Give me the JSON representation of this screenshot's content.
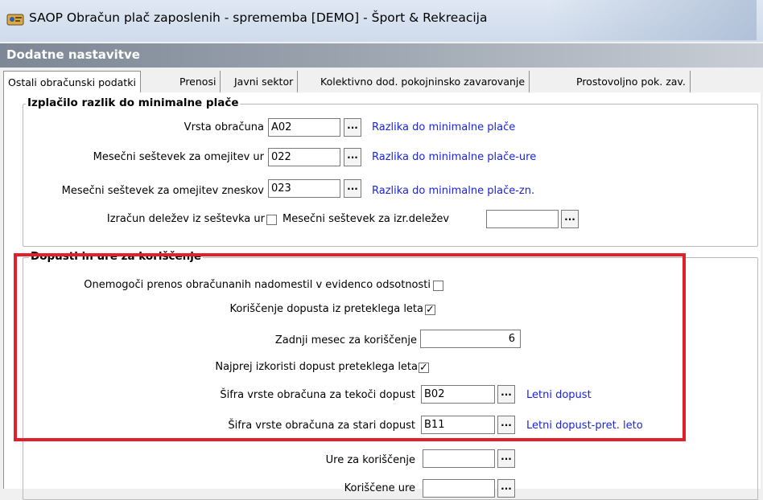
{
  "window": {
    "title": "SAOP Obračun plač zaposlenih - sprememba [DEMO] - Šport & Rekreacija",
    "section": "Dodatne nastavitve"
  },
  "tabs": [
    {
      "label": "Ostali obračunski podatki",
      "active": true
    },
    {
      "label": "Prenosi",
      "active": false
    },
    {
      "label": "Javni sektor",
      "active": false
    },
    {
      "label": "Kolektivno dod. pokojninsko zavarovanje",
      "active": false
    },
    {
      "label": "Prostovoljno pok. zav.",
      "active": false
    }
  ],
  "group1": {
    "title": "Izplačilo razlik do minimalne plače",
    "rows": [
      {
        "label": "Vrsta obračuna",
        "value": "A02",
        "desc": "Razlika do minimalne plače"
      },
      {
        "label": "Mesečni seštevek za omejitev ur",
        "value": "022",
        "desc": "Razlika do minimalne plače-ure"
      },
      {
        "label": "Mesečni seštevek za omejitev zneskov",
        "value": "023",
        "desc": "Razlika do minimalne plače-zn."
      }
    ],
    "shares_label": "Izračun deležev iz seštevka ur",
    "shares_checked": false,
    "shares_sum_label": "Mesečni seštevek za izr.deležev",
    "shares_sum_value": ""
  },
  "group2": {
    "title": "Dopusti in ure za koriščenje",
    "disable_transfer_label": "Onemogoči prenos obračunanih nadomestil v evidenco odsotnosti",
    "disable_transfer_checked": false,
    "use_prev_year_label": "Koriščenje dopusta iz preteklega leta",
    "use_prev_year_checked": true,
    "last_month_label": "Zadnji mesec za koriščenje",
    "last_month_value": "6",
    "first_use_prev_label": "Najprej izkoristi dopust preteklega leta",
    "first_use_prev_checked": true,
    "current_code_label": "Šifra vrste obračuna za tekoči dopust",
    "current_code_value": "B02",
    "current_code_desc": "Letni dopust",
    "old_code_label": "Šifra vrste obračuna za stari dopust",
    "old_code_value": "B11",
    "old_code_desc": "Letni dopust-pret. leto",
    "hours_label": "Ure za koriščenje",
    "hours_value": "",
    "used_hours_label": "Koriščene ure",
    "used_hours_value": ""
  },
  "ellipsis": "...",
  "colors": {
    "highlight": "#e3202a",
    "link": "#1b24d8"
  }
}
